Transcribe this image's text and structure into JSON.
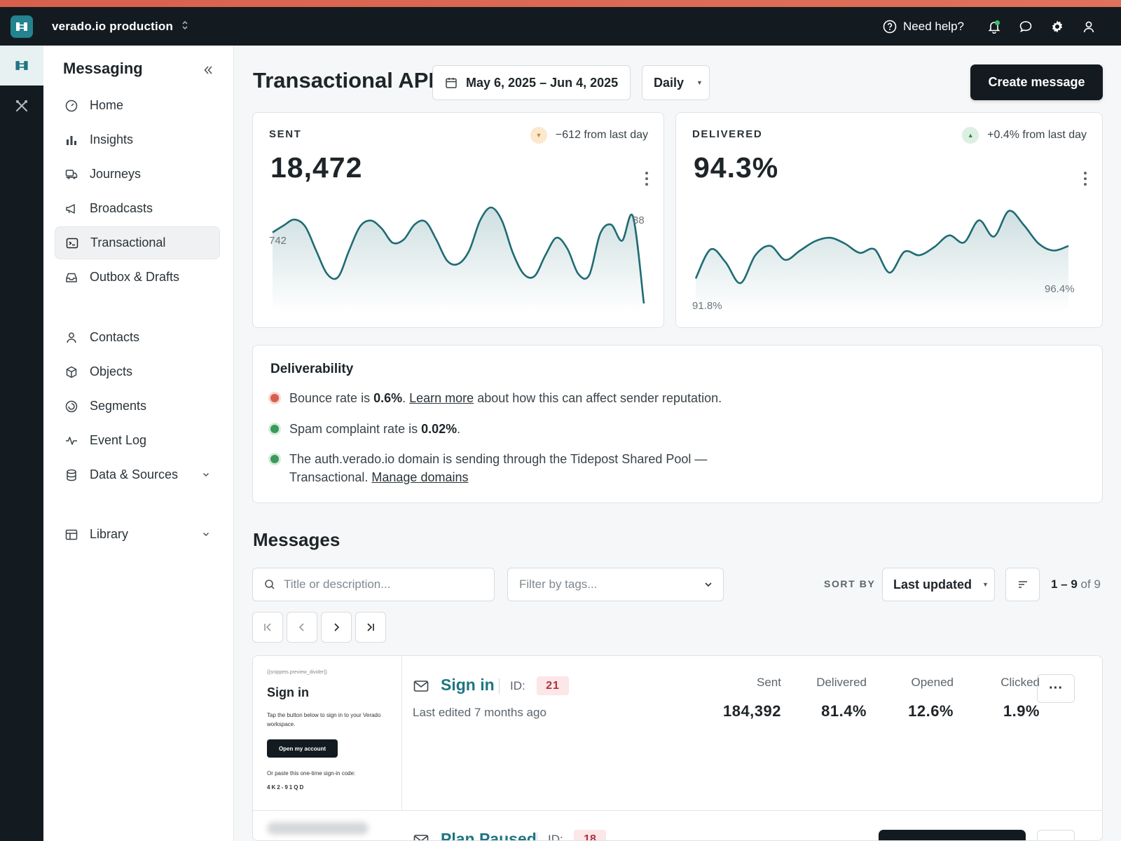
{
  "topbar": {
    "workspace_name": "verado.io production",
    "help_label": "Need help?",
    "brand_color": "#23838f",
    "accent_color": "#d7604c"
  },
  "sidebar": {
    "title": "Messaging",
    "items": [
      {
        "label": "Home",
        "icon": "home-icon"
      },
      {
        "label": "Insights",
        "icon": "bar-chart-icon"
      },
      {
        "label": "Journeys",
        "icon": "journeys-icon"
      },
      {
        "label": "Broadcasts",
        "icon": "megaphone-icon"
      },
      {
        "label": "Transactional",
        "icon": "terminal-icon",
        "active": true
      },
      {
        "label": "Outbox & Drafts",
        "icon": "inbox-icon"
      },
      {
        "label": "Contacts",
        "icon": "person-icon"
      },
      {
        "label": "Objects",
        "icon": "cube-icon"
      },
      {
        "label": "Segments",
        "icon": "segments-icon"
      },
      {
        "label": "Event Log",
        "icon": "activity-icon"
      },
      {
        "label": "Data & Sources",
        "icon": "database-icon",
        "expandable": true
      },
      {
        "label": "Library",
        "icon": "library-icon",
        "expandable": true
      }
    ]
  },
  "header": {
    "title": "Transactional API",
    "date_range": "May 6, 2025 – Jun 4, 2025",
    "interval": "Daily",
    "create_label": "Create message"
  },
  "stats": {
    "sent": {
      "label": "SENT",
      "value": "18,472",
      "change": "−612 from last day",
      "trend": "down",
      "start_label": "742",
      "end_label": "38"
    },
    "delivered": {
      "label": "DELIVERED",
      "value": "94.3%",
      "change": "+0.4% from last day",
      "trend": "up",
      "start_label": "91.8%",
      "end_label": "96.4%"
    }
  },
  "chart_data": [
    {
      "type": "area",
      "title": "SENT",
      "y_first": 742,
      "y_last": 38,
      "series": [
        {
          "values": [
            742,
            810,
            870,
            800,
            560,
            330,
            300,
            560,
            800,
            860,
            780,
            640,
            670,
            820,
            850,
            670,
            460,
            430,
            560,
            860,
            990,
            860,
            540,
            330,
            310,
            520,
            690,
            580,
            330,
            320,
            730,
            820,
            660,
            900,
            38
          ]
        }
      ]
    },
    {
      "type": "area",
      "title": "DELIVERED",
      "y_first": 91.8,
      "y_last": 96.4,
      "series": [
        {
          "values": [
            91.8,
            94.3,
            93.2,
            91.4,
            93.8,
            94.6,
            93.4,
            94.2,
            95.0,
            95.3,
            94.8,
            94.0,
            94.3,
            92.3,
            94.1,
            93.8,
            94.5,
            95.5,
            94.9,
            96.8,
            95.4,
            97.6,
            96.4,
            94.8,
            94.2,
            94.6
          ]
        }
      ]
    }
  ],
  "deliverability": {
    "title": "Deliverability",
    "bounce": {
      "prefix": "Bounce rate is ",
      "value": "0.6%",
      "mid": ". ",
      "link": "Learn more",
      "suffix": " about how this can affect sender reputation.",
      "status_color": "#d7604c"
    },
    "spam": {
      "prefix": "Spam complaint rate is ",
      "value": "0.02%",
      "suffix": ".",
      "status_color": "#3a9a5a"
    },
    "domain": {
      "line1": "The auth.verado.io domain is sending through the Tidepost Shared Pool —",
      "line2": "Transactional. ",
      "link": "Manage domains",
      "status_color": "#3a9a5a"
    }
  },
  "messages": {
    "title": "Messages",
    "search_placeholder": "Title or description...",
    "tags_placeholder": "Filter by tags...",
    "sort_by_label": "SORT BY",
    "sort_value": "Last updated",
    "range": "1 – 9",
    "of": "of",
    "total": "9",
    "rows": [
      {
        "name": "Sign in",
        "id_label": "ID:",
        "id": "21",
        "edited": "Last edited 7 months ago",
        "metrics": [
          {
            "label": "Sent",
            "value": "184,392"
          },
          {
            "label": "Delivered",
            "value": "81.4%"
          },
          {
            "label": "Opened",
            "value": "12.6%"
          },
          {
            "label": "Clicked",
            "value": "1.9%"
          }
        ],
        "preview": {
          "snippet": "{{snippets.preview_divider}}",
          "title": "Sign in",
          "body": "Tap the button below to sign in to your Verado workspace.",
          "button": "Open my account",
          "note": "Or paste this one-time sign-in code:",
          "code": "4K2-91QD"
        }
      },
      {
        "name": "Plan Paused",
        "id_label": "ID:",
        "id": "18"
      }
    ]
  }
}
